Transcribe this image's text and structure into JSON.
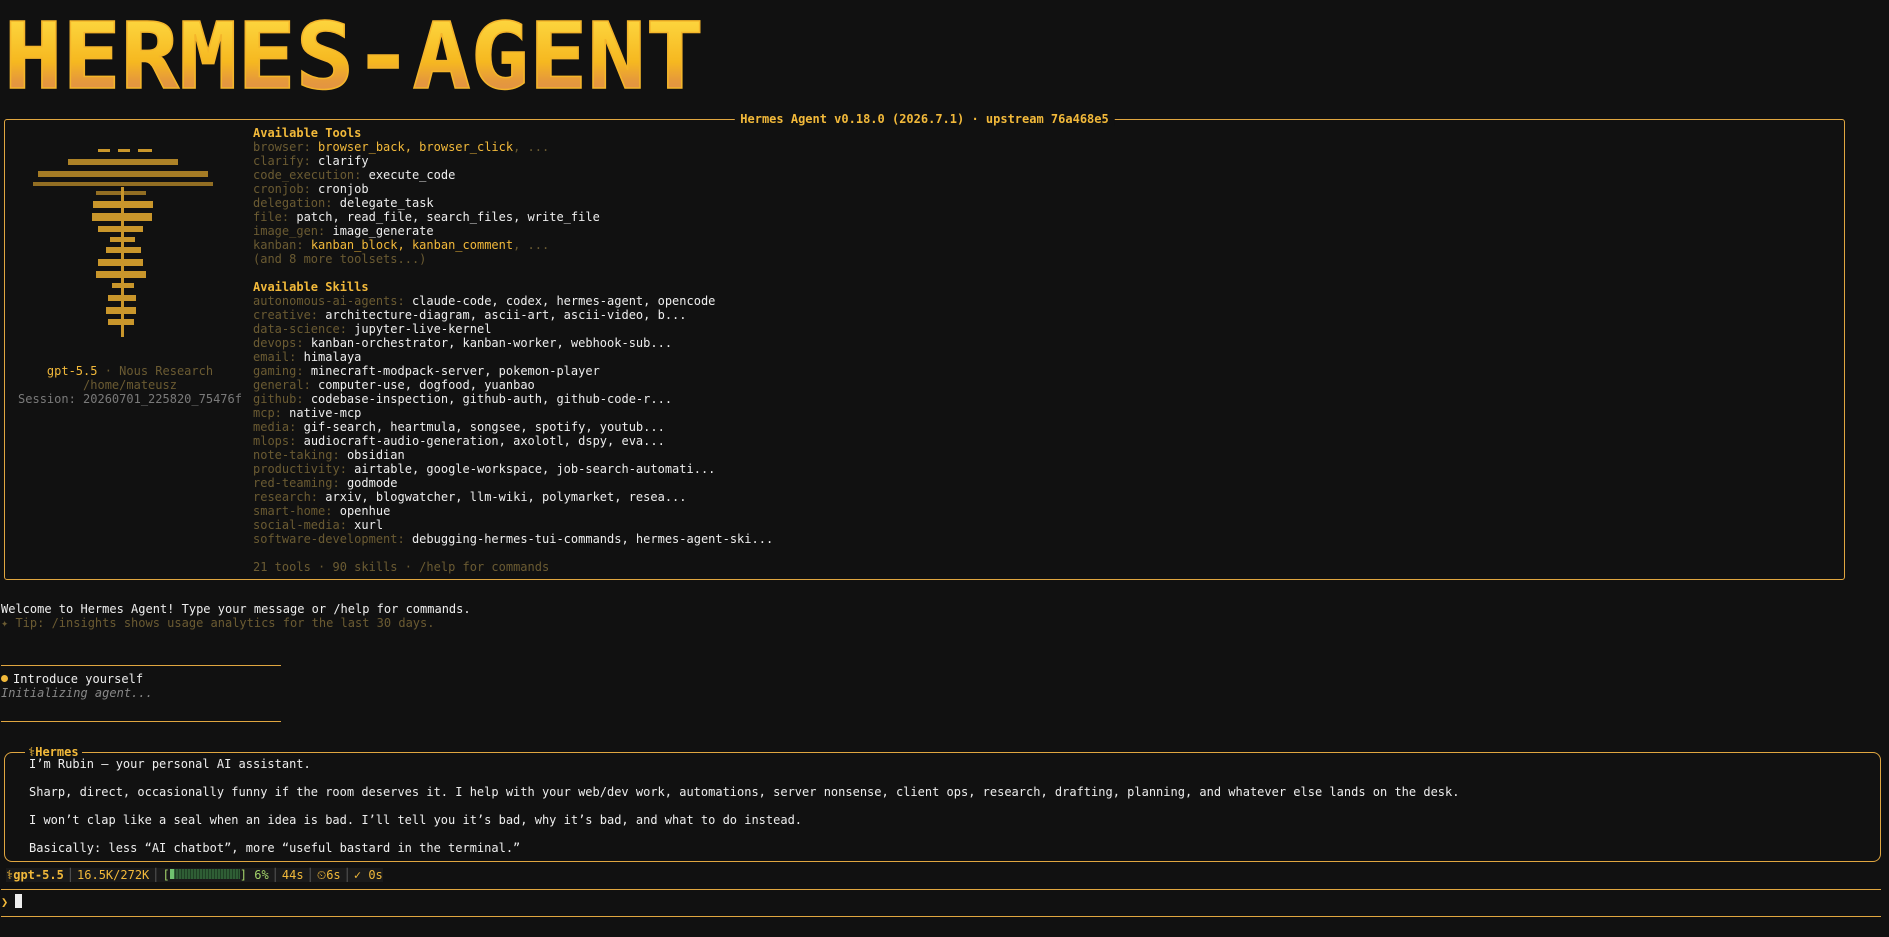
{
  "banner": {
    "text": "HERMES-AGENT"
  },
  "panel": {
    "title": "Hermes Agent v0.18.0 (2026.7.1) · upstream 76a468e5",
    "model": "gpt-5.5",
    "provider": " · Nous Research",
    "cwd": "/home/mateusz",
    "session": "Session: 20260701_225820_75476f"
  },
  "tools": {
    "heading": "Available Tools",
    "items": [
      {
        "cat": "browser:",
        "vals_gold": "browser_back, browser_click",
        "tail": ", ..."
      },
      {
        "cat": "clarify:",
        "val": "clarify"
      },
      {
        "cat": "code_execution:",
        "val": "execute_code"
      },
      {
        "cat": "cronjob:",
        "val": "cronjob"
      },
      {
        "cat": "delegation:",
        "val": "delegate_task"
      },
      {
        "cat": "file:",
        "val": "patch, read_file, search_files, write_file"
      },
      {
        "cat": "image_gen:",
        "val": "image_generate"
      },
      {
        "cat": "kanban:",
        "vals_gold": "kanban_block, kanban_comment",
        "tail": ", ..."
      }
    ],
    "more": "(and 8 more toolsets...)"
  },
  "skills": {
    "heading": "Available Skills",
    "items": [
      {
        "cat": "autonomous-ai-agents:",
        "val": "claude-code, codex, hermes-agent, opencode"
      },
      {
        "cat": "creative:",
        "val": "architecture-diagram, ascii-art, ascii-video, b..."
      },
      {
        "cat": "data-science:",
        "val": "jupyter-live-kernel"
      },
      {
        "cat": "devops:",
        "val": "kanban-orchestrator, kanban-worker, webhook-sub..."
      },
      {
        "cat": "email:",
        "val": "himalaya"
      },
      {
        "cat": "gaming:",
        "val": "minecraft-modpack-server, pokemon-player"
      },
      {
        "cat": "general:",
        "val": "computer-use, dogfood, yuanbao"
      },
      {
        "cat": "github:",
        "val": "codebase-inspection, github-auth, github-code-r..."
      },
      {
        "cat": "mcp:",
        "val": "native-mcp"
      },
      {
        "cat": "media:",
        "val": "gif-search, heartmula, songsee, spotify, youtub..."
      },
      {
        "cat": "mlops:",
        "val": "audiocraft-audio-generation, axolotl, dspy, eva..."
      },
      {
        "cat": "note-taking:",
        "val": "obsidian"
      },
      {
        "cat": "productivity:",
        "val": "airtable, google-workspace, job-search-automati..."
      },
      {
        "cat": "red-teaming:",
        "val": "godmode"
      },
      {
        "cat": "research:",
        "val": "arxiv, blogwatcher, llm-wiki, polymarket, resea..."
      },
      {
        "cat": "smart-home:",
        "val": "openhue"
      },
      {
        "cat": "social-media:",
        "val": "xurl"
      },
      {
        "cat": "software-development:",
        "val": "debugging-hermes-tui-commands, hermes-agent-ski..."
      }
    ],
    "summary": "21 tools · 90 skills · /help for commands"
  },
  "welcome": {
    "message": "Welcome to Hermes Agent! Type your message or /help for commands.",
    "tip": "✦ Tip: /insights shows usage analytics for the last 30 days."
  },
  "user_turn": {
    "message": "Introduce yourself",
    "status": "Initializing agent..."
  },
  "reply": {
    "title": "⚕Hermes",
    "lines": [
      "I’m Rubin — your personal AI assistant.",
      "",
      "Sharp, direct, occasionally funny if the room deserves it. I help with your web/dev work, automations, server nonsense, client ops, research, drafting, planning, and whatever else lands on the desk.",
      "",
      "I won’t clap like a seal when an idea is bad. I’ll tell you it’s bad, why it’s bad, and what to do instead.",
      "",
      "Basically: less “AI chatbot”, more “useful bastard in the terminal.”"
    ]
  },
  "status_bar": {
    "model": "⚕gpt-5.5",
    "tokens": "16.5K/272K",
    "context_percent": "6%",
    "context_fraction": 0.06,
    "elapsed": "44s",
    "timer": "⏲6s",
    "check": "✓ 0s"
  },
  "prompt": {
    "symbol": "❯"
  },
  "colors": {
    "accent": "#f2b93a",
    "muted": "#6b5b32",
    "border": "#e0a640",
    "bg": "#111111"
  }
}
